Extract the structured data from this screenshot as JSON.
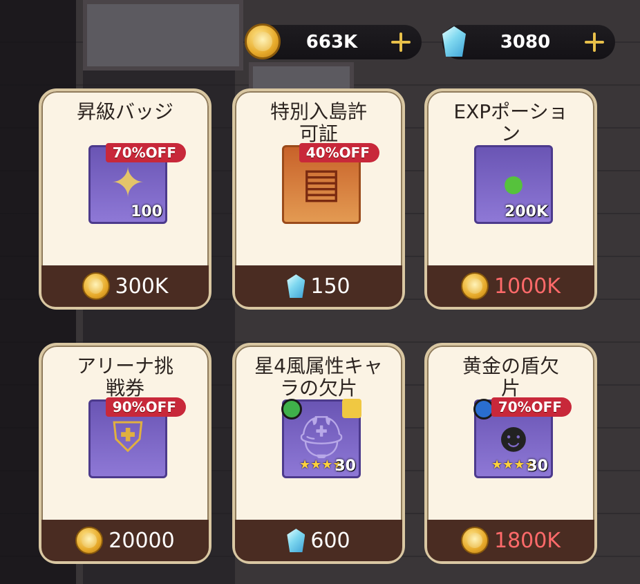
{
  "currencies": [
    {
      "icon": "gold-coin-icon",
      "value": "663K"
    },
    {
      "icon": "diamond-gem-icon",
      "value": "3080"
    }
  ],
  "items": [
    {
      "name": "昇級バッジ",
      "discount": "70%OFF",
      "qty": "100",
      "price_icon": "gold-coin-icon",
      "price": "300K",
      "affordable": true,
      "icon": "badge-icon",
      "frame": "purple"
    },
    {
      "name": "特別入島許可証",
      "discount": "40%OFF",
      "qty": "",
      "price_icon": "diamond-gem-icon",
      "price": "150",
      "affordable": true,
      "icon": "island-pass-icon",
      "frame": "orange"
    },
    {
      "name": "EXPポーション",
      "discount": "",
      "qty": "200K",
      "price_icon": "gold-coin-icon",
      "price": "1000K",
      "affordable": false,
      "icon": "exp-potion-icon",
      "frame": "purple"
    },
    {
      "name": "アリーナ挑戦券",
      "discount": "90%OFF",
      "qty": "",
      "price_icon": "gold-coin-icon",
      "price": "20000",
      "affordable": true,
      "icon": "arena-ticket-icon",
      "frame": "purple"
    },
    {
      "name": "星4風属性キャラの欠片",
      "discount": "",
      "qty": "30",
      "stars": "★★★★",
      "price_icon": "diamond-gem-icon",
      "price": "600",
      "affordable": true,
      "icon": "knight-helmet-icon",
      "frame": "purple"
    },
    {
      "name": "黄金の盾欠片",
      "discount": "70%OFF",
      "qty": "30",
      "stars": "★★★★",
      "price_icon": "gold-coin-icon",
      "price": "1800K",
      "affordable": false,
      "icon": "character-portrait-icon",
      "frame": "purple"
    }
  ],
  "colors": {
    "affordable": "#ffffff",
    "unaffordable": "#ff6a6a",
    "discount_badge": "#c8283a"
  }
}
